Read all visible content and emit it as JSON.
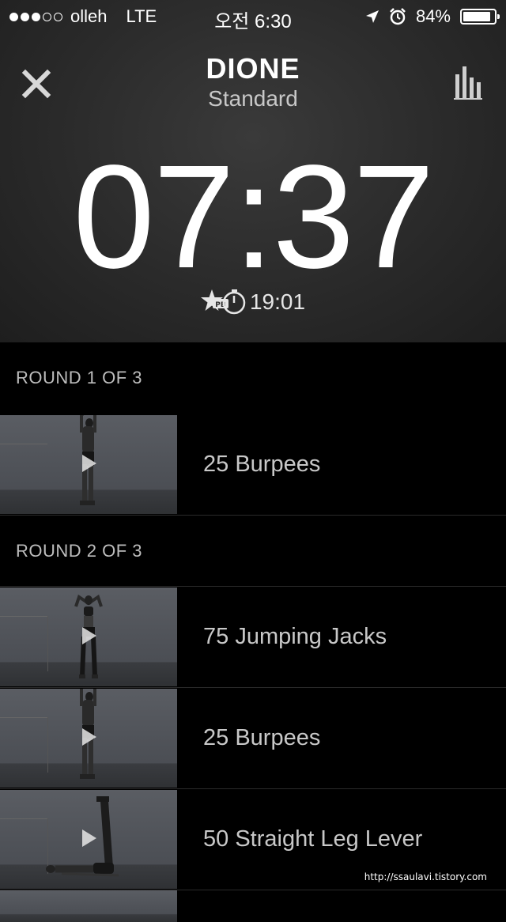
{
  "status_bar": {
    "carrier": "olleh",
    "network": "LTE",
    "time": "오전 6:30",
    "battery": "84%",
    "signal_bars": 3,
    "battery_level": 0.84,
    "icons": [
      "location-arrow-icon",
      "alarm-icon",
      "battery-icon"
    ]
  },
  "workout": {
    "title": "DIONE",
    "subtitle": "Standard",
    "timer": "07:37",
    "personal_best": "19:01"
  },
  "rounds": [
    {
      "label": "ROUND 1 OF 3",
      "exercises": [
        {
          "name": "25 Burpees"
        }
      ]
    },
    {
      "label": "ROUND 2 OF 3",
      "exercises": [
        {
          "name": "75 Jumping Jacks"
        },
        {
          "name": "25 Burpees"
        },
        {
          "name": "50 Straight Leg Lever"
        }
      ]
    }
  ],
  "watermark": "http://ssaulavi.tistory.com",
  "colors": {
    "header_bg": "#2e2e2e",
    "list_bg": "#000000",
    "text_primary": "#ffffff",
    "text_secondary": "#c8c8c8"
  }
}
